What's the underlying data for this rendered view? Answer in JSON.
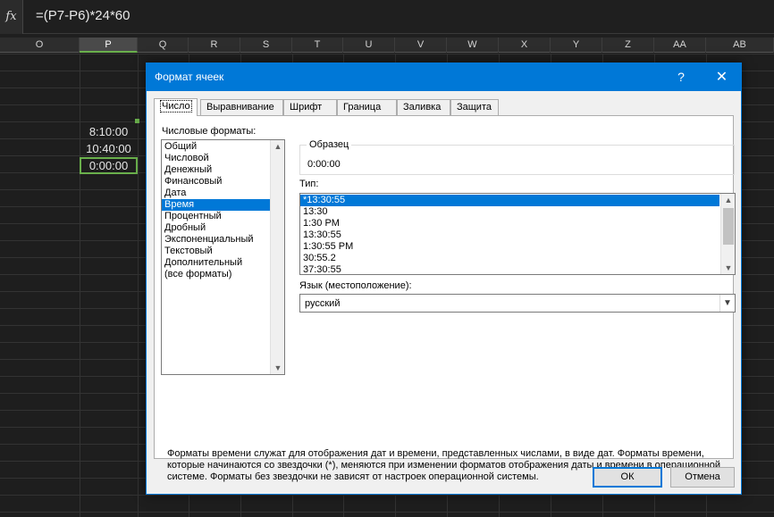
{
  "formula_bar": {
    "fx_label": "fx",
    "formula": "=(P7-P6)*24*60"
  },
  "columns": [
    "O",
    "P",
    "Q",
    "R",
    "S",
    "T",
    "U",
    "V",
    "W",
    "X",
    "Y",
    "Z",
    "AA",
    "AB"
  ],
  "cells": {
    "p6": "8:10:00",
    "p7": "10:40:00",
    "p8": "0:00:00"
  },
  "dialog": {
    "title": "Формат ячеек",
    "help_label": "?",
    "close_label": "✕",
    "tabs": [
      "Число",
      "Выравнивание",
      "Шрифт",
      "Граница",
      "Заливка",
      "Защита"
    ],
    "active_tab": "Число",
    "formats_label": "Числовые форматы:",
    "formats": [
      "Общий",
      "Числовой",
      "Денежный",
      "Финансовый",
      "Дата",
      "Время",
      "Процентный",
      "Дробный",
      "Экспоненциальный",
      "Текстовый",
      "Дополнительный",
      "(все форматы)"
    ],
    "selected_format": "Время",
    "sample_label": "Образец",
    "sample_value": "0:00:00",
    "type_label": "Тип:",
    "types": [
      "*13:30:55",
      "13:30",
      "1:30 PM",
      "13:30:55",
      "1:30:55 PM",
      "30:55.2",
      "37:30:55"
    ],
    "selected_type": "*13:30:55",
    "locale_label": "Язык (местоположение):",
    "locale_value": "русский",
    "description": "Форматы времени служат для отображения дат и времени, представленных числами, в виде дат. Форматы времени, которые начинаются со звездочки (*), меняются при изменении форматов отображения даты и времени в операционной системе. Форматы без звездочки не зависят от настроек операционной системы.",
    "ok_label": "ОК",
    "cancel_label": "Отмена"
  },
  "colors": {
    "accent": "#0078d7",
    "selection_border": "#6ab04c",
    "sheet_bg": "#1e1e1e"
  }
}
